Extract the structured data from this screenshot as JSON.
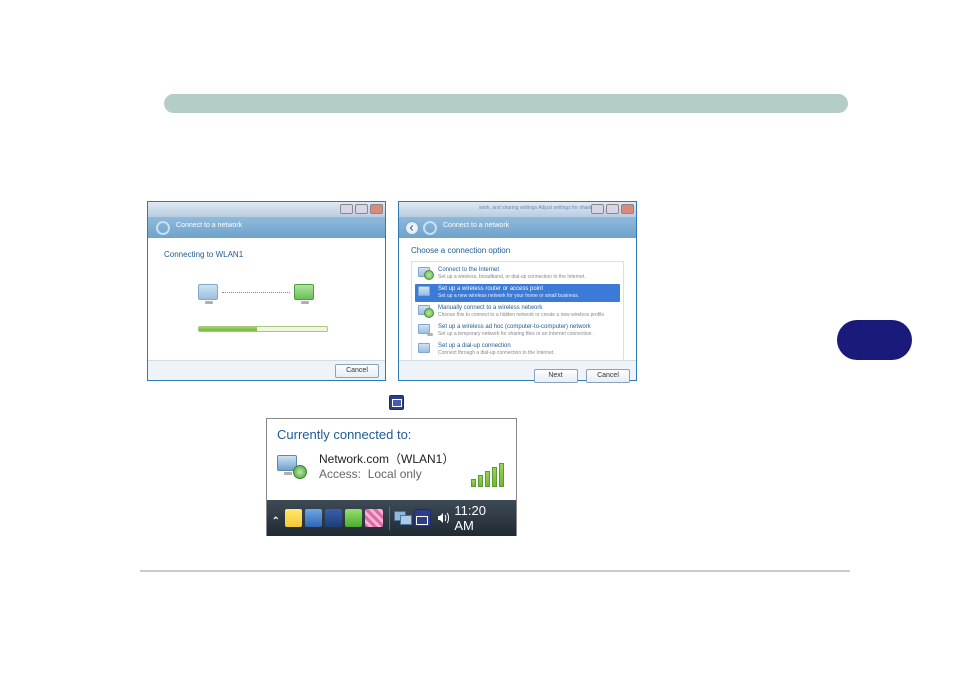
{
  "topbar": {},
  "shot1": {
    "banner_title": "Connect to a network",
    "connecting_msg": "Connecting to WLAN1",
    "cancel_label": "Cancel"
  },
  "shot2": {
    "faded_header": "work, and sharing settings    Adjust settings for sharing and discovery",
    "banner_title": "Connect to a network",
    "choose_label": "Choose a connection option",
    "options": [
      {
        "title": "Connect to the Internet",
        "desc": "Set up a wireless, broadband, or dial-up connection to the Internet."
      },
      {
        "title": "Set up a wireless router or access point",
        "desc": "Set up a new wireless network for your home or small business."
      },
      {
        "title": "Manually connect to a wireless network",
        "desc": "Choose this to connect to a hidden network or create a new wireless profile."
      },
      {
        "title": "Set up a wireless ad hoc (computer-to-computer) network",
        "desc": "Set up a temporary network for sharing files or an Internet connection."
      },
      {
        "title": "Set up a dial-up connection",
        "desc": "Connect through a dial-up connection to the Internet."
      }
    ],
    "next_label": "Next",
    "cancel_label": "Cancel"
  },
  "shot3": {
    "tooltip_title": "Currently connected to:",
    "network_name": "Network.com（WLAN1）",
    "access_label": "Access:",
    "access_value": "Local only",
    "clock": "11:20 AM"
  }
}
